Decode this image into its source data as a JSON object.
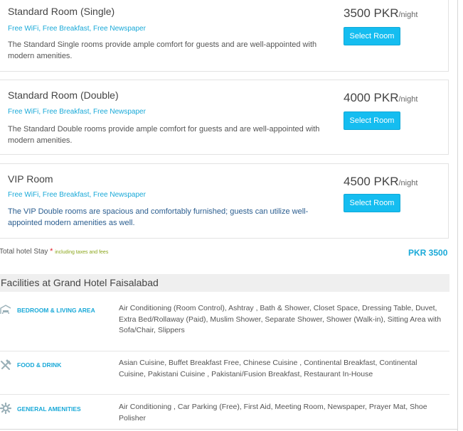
{
  "rooms": [
    {
      "name": "Standard Room (Single)",
      "features": "Free WiFi, Free Breakfast, Free Newspaper",
      "description": "The Standard Single rooms provide ample comfort for guests and are well-appointed with modern amenities.",
      "price": "3500 PKR",
      "per": "/night",
      "button": "Select Room"
    },
    {
      "name": "Standard Room (Double)",
      "features": "Free WiFi, Free Breakfast, Free Newspaper",
      "description": "The Standard Double rooms provide ample comfort for guests and are well-appointed with modern amenities.",
      "price": "4000 PKR",
      "per": "/night",
      "button": "Select Room"
    },
    {
      "name": "VIP Room",
      "features": "Free WiFi, Free Breakfast, Free Newspaper",
      "description": "The VIP Double rooms are spacious and comfortably furnished; guests can utilize well-appointed modern amenities as well.",
      "price": "4500 PKR",
      "per": "/night",
      "button": "Select Room"
    }
  ],
  "total": {
    "label": "Total hotel Stay",
    "star": "*",
    "note": "including taxes and fees",
    "value": "PKR 3500"
  },
  "facilities": {
    "title": "Facilities at Grand Hotel Faisalabad",
    "items": [
      {
        "category": "BEDROOM & LIVING AREA",
        "icon": "bed-icon",
        "list": "Air Conditioning (Room Control), Ashtray , Bath & Shower, Closet Space, Dressing Table, Duvet, Extra Bed/Rollaway (Paid), Muslim Shower, Separate Shower, Shower (Walk-in), Sitting Area with Sofa/Chair, Slippers"
      },
      {
        "category": "FOOD & DRINK",
        "icon": "fork-knife-icon",
        "list": "Asian Cuisine, Buffet Breakfast Free, Chinese Cuisine , Continental Breakfast, Continental Cuisine, Pakistani Cuisine , Pakistani/Fusion Breakfast, Restaurant In-House"
      },
      {
        "category": "GENERAL AMENITIES",
        "icon": "gear-icon",
        "list": "Air Conditioning , Car Parking (Free), First Aid, Meeting Room, Newspaper, Prayer Mat, Shoe Polisher"
      }
    ]
  },
  "colors": {
    "accent": "#19a9d8",
    "button": "#15bdf0",
    "star": "#e0202a",
    "tax_note": "#8aa51a"
  }
}
